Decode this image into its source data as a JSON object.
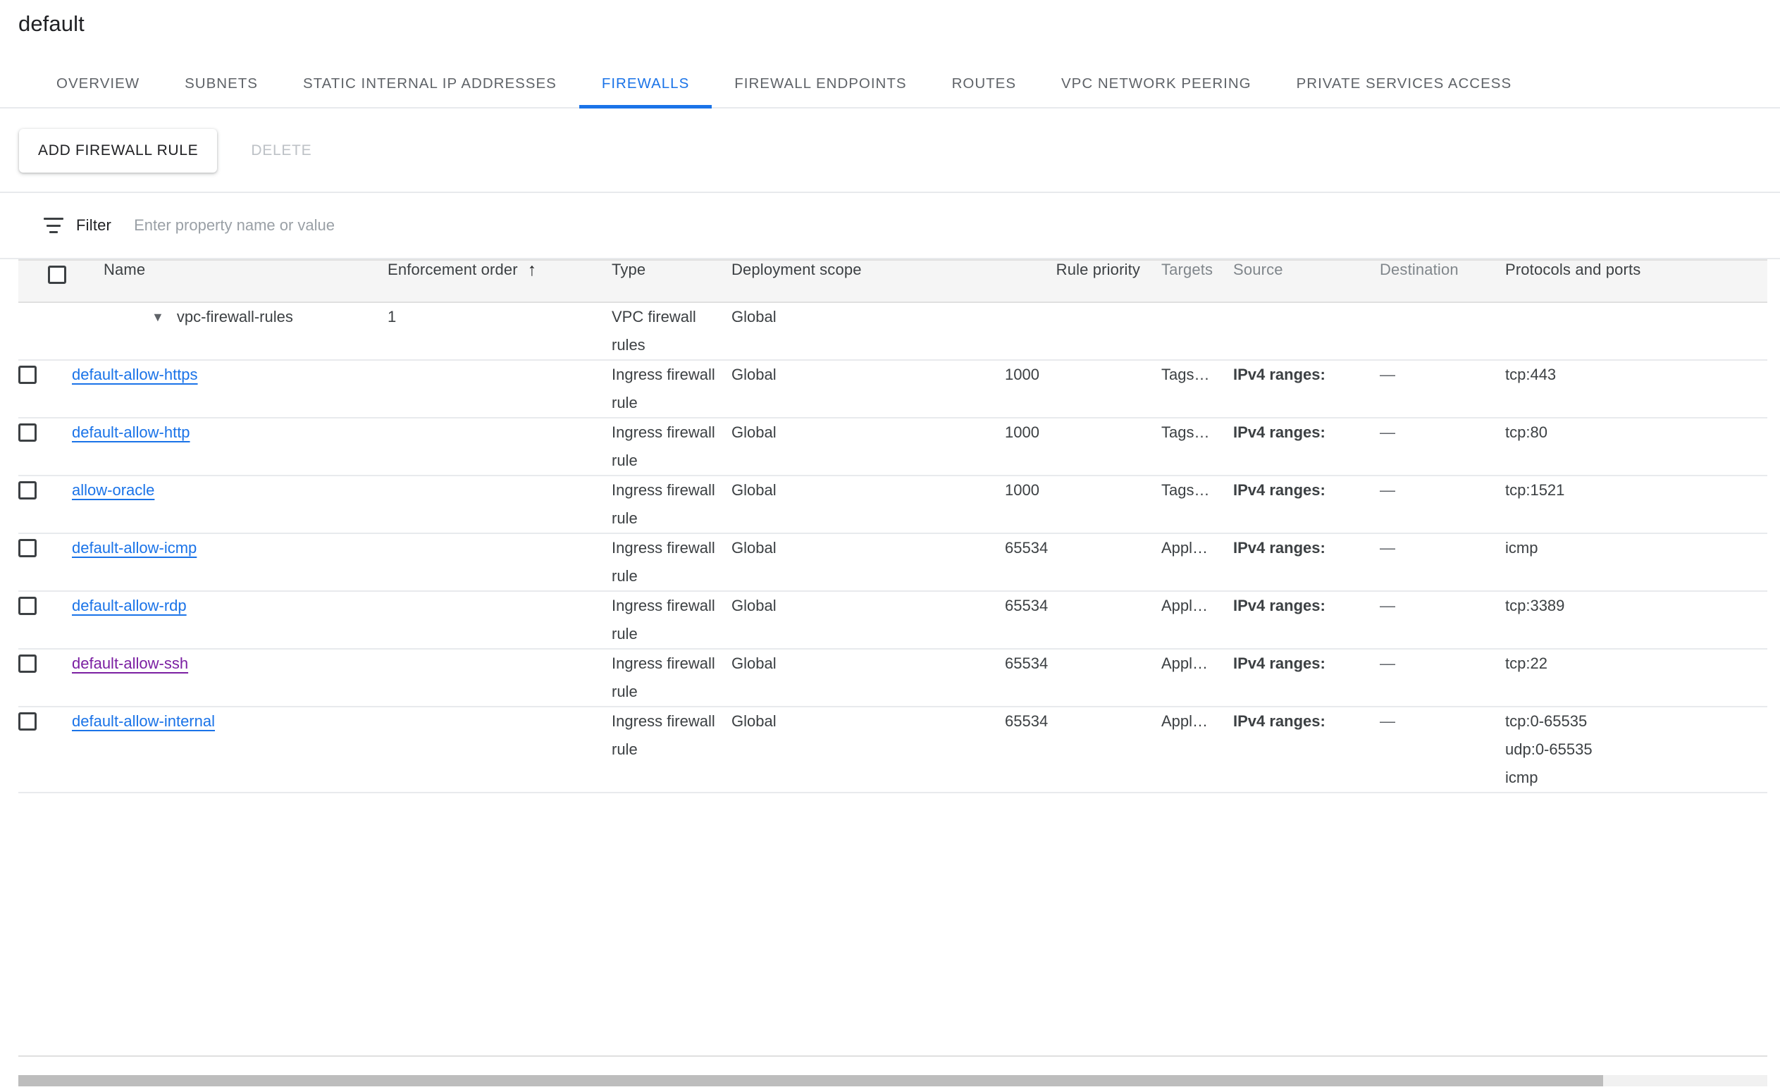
{
  "header": {
    "title": "default"
  },
  "tabs": [
    {
      "label": "OVERVIEW",
      "active": false
    },
    {
      "label": "SUBNETS",
      "active": false
    },
    {
      "label": "STATIC INTERNAL IP ADDRESSES",
      "active": false
    },
    {
      "label": "FIREWALLS",
      "active": true
    },
    {
      "label": "FIREWALL ENDPOINTS",
      "active": false
    },
    {
      "label": "ROUTES",
      "active": false
    },
    {
      "label": "VPC NETWORK PEERING",
      "active": false
    },
    {
      "label": "PRIVATE SERVICES ACCESS",
      "active": false
    }
  ],
  "toolbar": {
    "add_label": "ADD FIREWALL RULE",
    "delete_label": "DELETE"
  },
  "filter": {
    "label": "Filter",
    "placeholder": "Enter property name or value",
    "value": ""
  },
  "table": {
    "columns": {
      "name": "Name",
      "enforcement_order": "Enforcement order",
      "type": "Type",
      "deployment_scope": "Deployment scope",
      "rule_priority": "Rule priority",
      "targets": "Targets",
      "source": "Source",
      "destination": "Destination",
      "protocols_and_ports": "Protocols and ports"
    },
    "sort": {
      "column": "Enforcement order",
      "direction": "ascending",
      "glyph": "↑"
    },
    "group_row": {
      "caret": "▼",
      "name": "vpc-firewall-rules",
      "enforcement_order": "1",
      "type": "VPC firewall rules",
      "deployment_scope": "Global",
      "rule_priority": "",
      "targets": "",
      "source": "",
      "destination": "",
      "protocols_and_ports": ""
    },
    "rows": [
      {
        "name": "default-allow-https",
        "visited": false,
        "enforcement_order": "",
        "type": "Ingress firewall rule",
        "deployment_scope": "Global",
        "rule_priority": "1000",
        "targets": "Tags…",
        "source": "IPv4 ranges:",
        "destination": "—",
        "protocols_and_ports": [
          "tcp:443"
        ]
      },
      {
        "name": "default-allow-http",
        "visited": false,
        "enforcement_order": "",
        "type": "Ingress firewall rule",
        "deployment_scope": "Global",
        "rule_priority": "1000",
        "targets": "Tags…",
        "source": "IPv4 ranges:",
        "destination": "—",
        "protocols_and_ports": [
          "tcp:80"
        ]
      },
      {
        "name": "allow-oracle",
        "visited": false,
        "enforcement_order": "",
        "type": "Ingress firewall rule",
        "deployment_scope": "Global",
        "rule_priority": "1000",
        "targets": "Tags…",
        "source": "IPv4 ranges:",
        "destination": "—",
        "protocols_and_ports": [
          "tcp:1521"
        ]
      },
      {
        "name": "default-allow-icmp",
        "visited": false,
        "enforcement_order": "",
        "type": "Ingress firewall rule",
        "deployment_scope": "Global",
        "rule_priority": "65534",
        "targets": "Appl…",
        "source": "IPv4 ranges:",
        "destination": "—",
        "protocols_and_ports": [
          "icmp"
        ]
      },
      {
        "name": "default-allow-rdp",
        "visited": false,
        "enforcement_order": "",
        "type": "Ingress firewall rule",
        "deployment_scope": "Global",
        "rule_priority": "65534",
        "targets": "Appl…",
        "source": "IPv4 ranges:",
        "destination": "—",
        "protocols_and_ports": [
          "tcp:3389"
        ]
      },
      {
        "name": "default-allow-ssh",
        "visited": true,
        "enforcement_order": "",
        "type": "Ingress firewall rule",
        "deployment_scope": "Global",
        "rule_priority": "65534",
        "targets": "Appl…",
        "source": "IPv4 ranges:",
        "destination": "—",
        "protocols_and_ports": [
          "tcp:22"
        ]
      },
      {
        "name": "default-allow-internal",
        "visited": false,
        "enforcement_order": "",
        "type": "Ingress firewall rule",
        "deployment_scope": "Global",
        "rule_priority": "65534",
        "targets": "Appl…",
        "source": "IPv4 ranges:",
        "destination": "—",
        "protocols_and_ports": [
          "tcp:0-65535",
          "udp:0-65535",
          "icmp"
        ]
      }
    ]
  },
  "colors": {
    "accent": "#1a73e8",
    "visited_link": "#7b1fa2",
    "text_primary": "#202124",
    "text_secondary": "#5f6368",
    "text_muted": "#80868b",
    "header_bg": "#f5f5f5",
    "divider": "#e8eaed"
  }
}
